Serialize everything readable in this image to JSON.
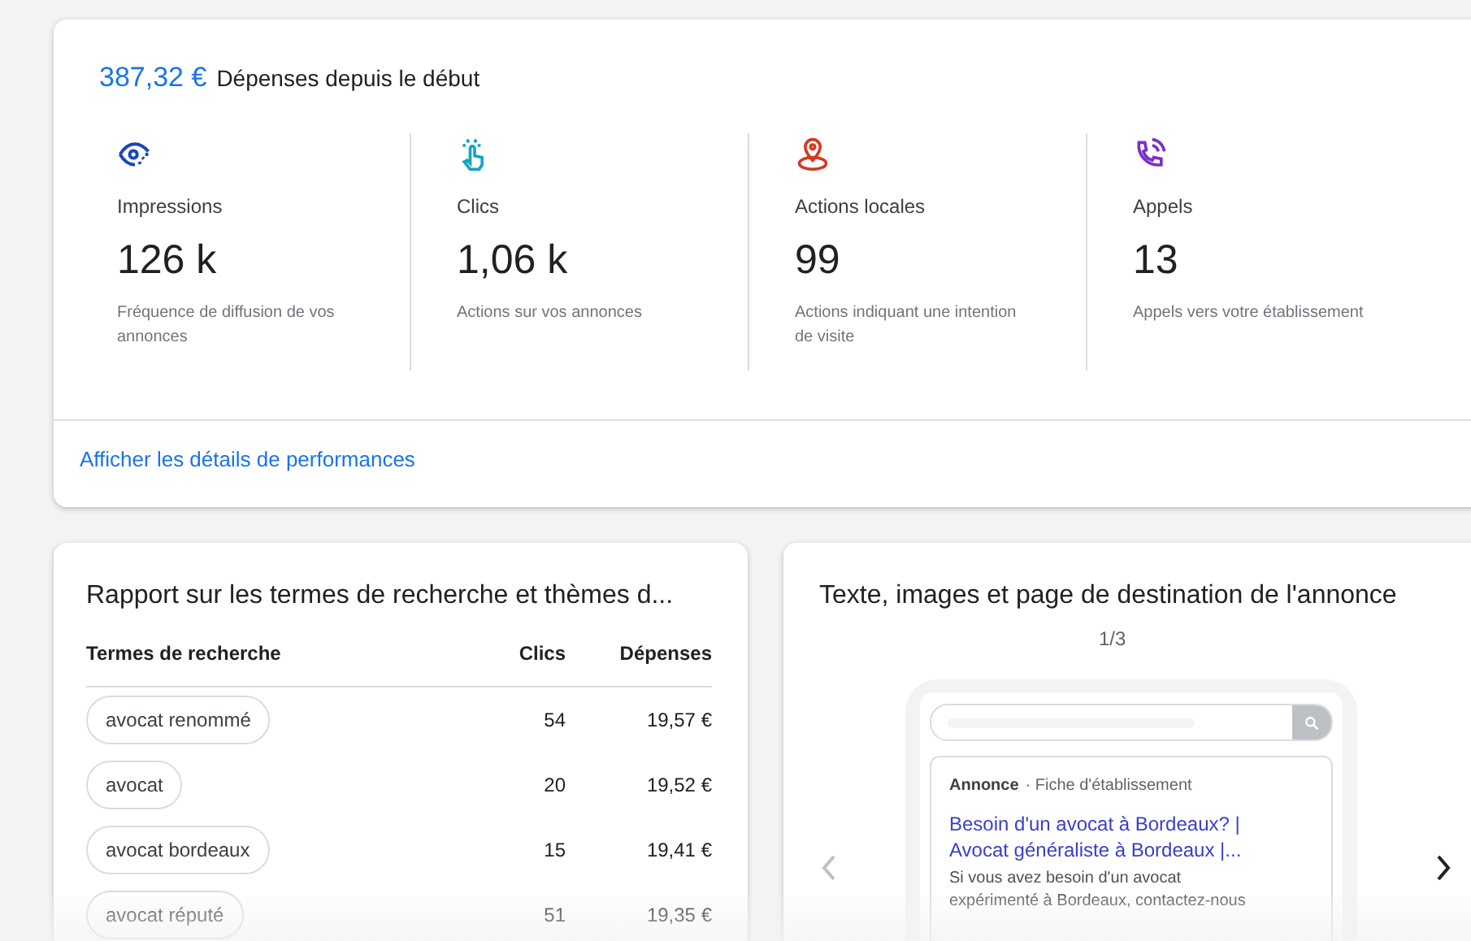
{
  "summary": {
    "amount": "387,32 €",
    "label": "Dépenses depuis le début"
  },
  "metrics": [
    {
      "label": "Impressions",
      "value": "126 k",
      "description": "Fréquence de diffusion de vos annonces",
      "color": "#1a47b8"
    },
    {
      "label": "Clics",
      "value": "1,06 k",
      "description": "Actions sur vos annonces",
      "color": "#12a4c9"
    },
    {
      "label": "Actions locales",
      "value": "99",
      "description": "Actions indiquant une intention de visite",
      "color": "#d33a1f"
    },
    {
      "label": "Appels",
      "value": "13",
      "description": "Appels vers votre établissement",
      "color": "#7b2fc9"
    }
  ],
  "details_link": "Afficher les détails de performances",
  "search_terms": {
    "title": "Rapport sur les termes de recherche et thèmes d...",
    "columns": [
      "Termes de recherche",
      "Clics",
      "Dépenses"
    ],
    "rows": [
      {
        "term": "avocat renommé",
        "clicks": "54",
        "spend": "19,57 €"
      },
      {
        "term": "avocat",
        "clicks": "20",
        "spend": "19,52 €"
      },
      {
        "term": "avocat bordeaux",
        "clicks": "15",
        "spend": "19,41 €"
      },
      {
        "term": "avocat réputé",
        "clicks": "51",
        "spend": "19,35 €"
      }
    ]
  },
  "ad_preview": {
    "title": "Texte, images et page de destination de l'annonce",
    "pager": "1/3",
    "ad": {
      "badge": "Annonce",
      "source": "· Fiche d'établissement",
      "headline": "Besoin d'un avocat à Bordeaux? | Avocat généraliste à Bordeaux |...",
      "body": "Si vous avez besoin d'un avocat expérimenté à Bordeaux, contactez-nous"
    }
  }
}
